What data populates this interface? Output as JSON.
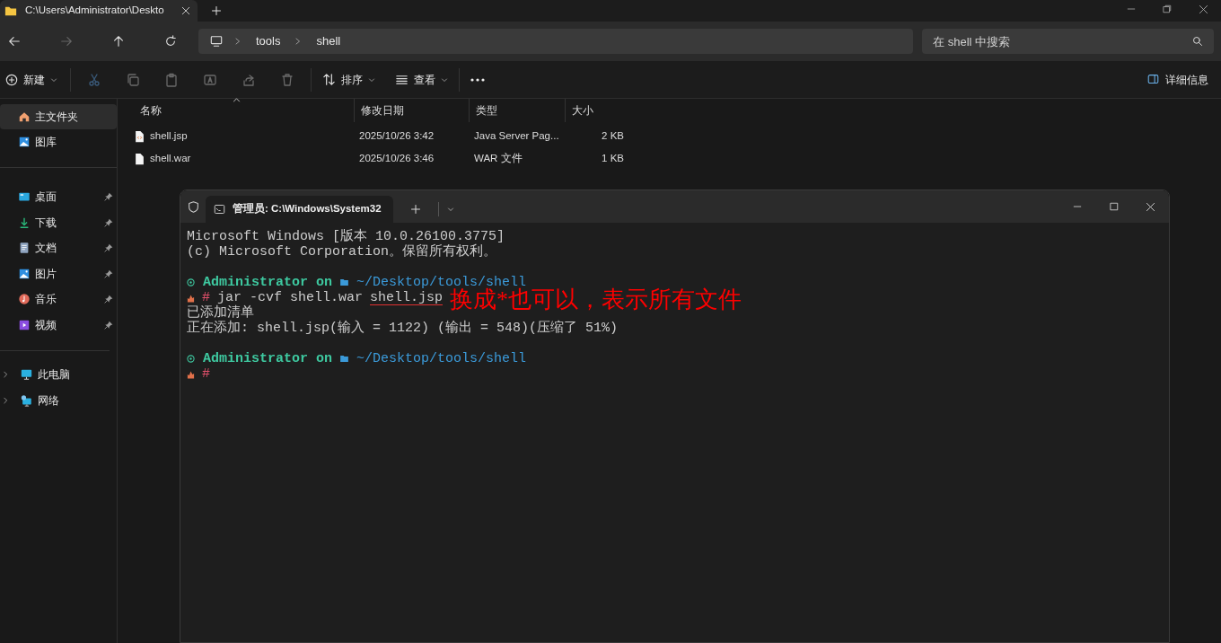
{
  "explorer": {
    "tab": {
      "title": "C:\\Users\\Administrator\\Deskto"
    },
    "address": [
      "tools",
      "shell"
    ],
    "search": {
      "placeholder": "在 shell 中搜索"
    },
    "toolbar": {
      "new": "新建",
      "sort": "排序",
      "view": "查看",
      "details": "详细信息"
    },
    "sidebar": {
      "top": [
        {
          "label": "主文件夹",
          "kind": "home",
          "selected": true
        },
        {
          "label": "图库",
          "kind": "gallery",
          "selected": false
        }
      ],
      "pinned": [
        {
          "label": "桌面",
          "kind": "desktop",
          "pinned": true
        },
        {
          "label": "下载",
          "kind": "download",
          "pinned": true
        },
        {
          "label": "文档",
          "kind": "document",
          "pinned": true
        },
        {
          "label": "图片",
          "kind": "picture",
          "pinned": true
        },
        {
          "label": "音乐",
          "kind": "music",
          "pinned": true
        },
        {
          "label": "视频",
          "kind": "video",
          "pinned": true
        }
      ],
      "tree": [
        {
          "label": "此电脑",
          "kind": "pc",
          "expanded": false
        },
        {
          "label": "网络",
          "kind": "network",
          "expanded": false
        }
      ]
    },
    "table": {
      "columns": [
        "名称",
        "修改日期",
        "类型",
        "大小"
      ],
      "rows": [
        {
          "name": "shell.jsp",
          "kind": "code",
          "modified": "2025/10/26 3:42",
          "type": "Java Server Pag...",
          "size": "2 KB"
        },
        {
          "name": "shell.war",
          "kind": "file",
          "modified": "2025/10/26 3:46",
          "type": "WAR 文件",
          "size": "1 KB"
        }
      ]
    }
  },
  "terminal": {
    "tab": {
      "title": "管理员: C:\\Windows\\System32"
    },
    "lines": [
      {
        "kind": "text",
        "text": "Microsoft Windows [版本 10.0.26100.3775]"
      },
      {
        "kind": "text",
        "text": "(c) Microsoft Corporation。保留所有权利。"
      },
      {
        "kind": "blank"
      },
      {
        "kind": "prompt",
        "user": "Administrator",
        "word": "on",
        "path": "~/Desktop/tools/shell"
      },
      {
        "kind": "command",
        "symbol": "#",
        "command": "jar -cvf shell.war",
        "underlined": "shell.jsp",
        "annotation": "换成*也可以，表示所有文件"
      },
      {
        "kind": "text",
        "text": "已添加清单"
      },
      {
        "kind": "text",
        "text": "正在添加: shell.jsp(输入 = 1122) (输出 = 548)(压缩了 51%)"
      },
      {
        "kind": "blank"
      },
      {
        "kind": "prompt",
        "user": "Administrator",
        "word": "on",
        "path": "~/Desktop/tools/shell"
      },
      {
        "kind": "command",
        "symbol": "#"
      }
    ]
  }
}
